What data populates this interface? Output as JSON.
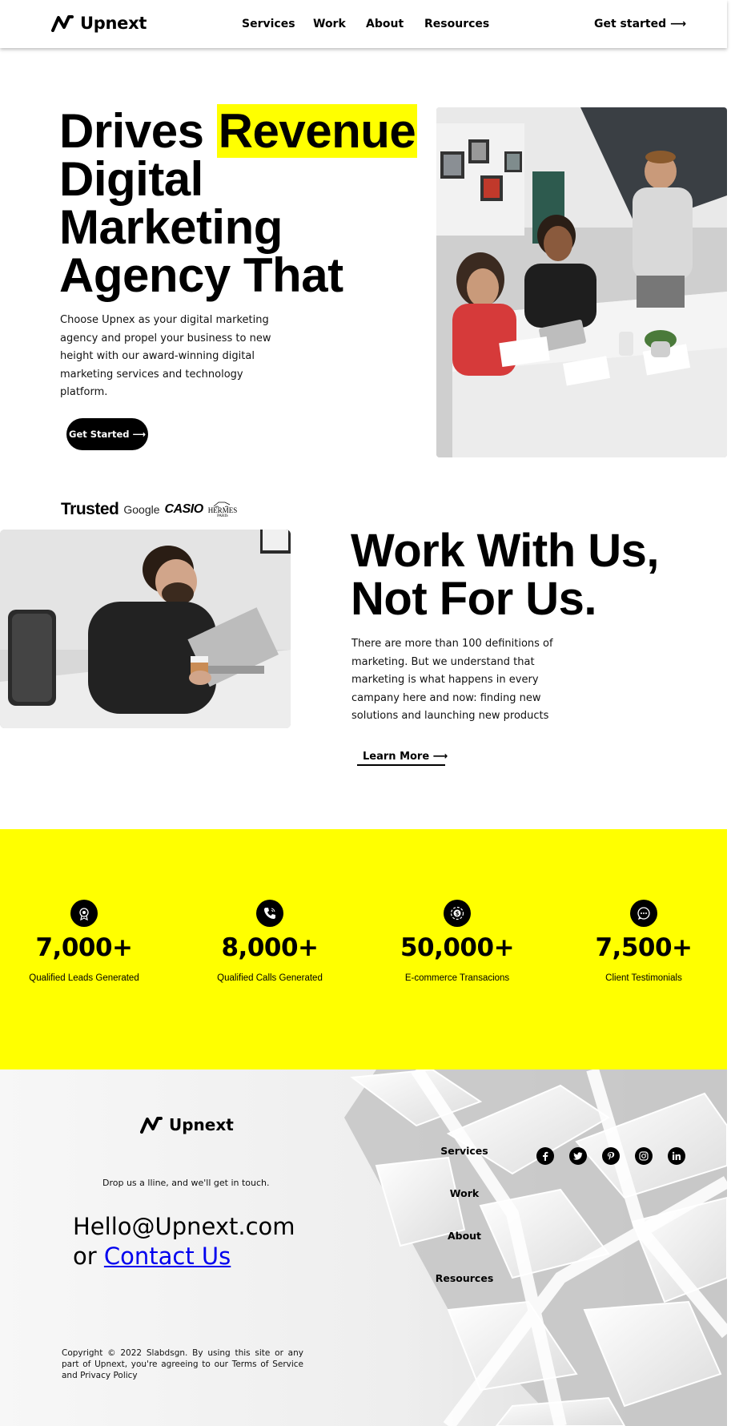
{
  "header": {
    "brand": "Upnext",
    "nav": [
      "Services",
      "Work",
      "About",
      "Resources"
    ],
    "cta": "Get started ⟶"
  },
  "hero": {
    "title_prefix": "Drives ",
    "title_highlight": "Revenue",
    "title_rest": "Digital Marketing Agency That",
    "description": "Choose Upnex as your digital marketing agency and propel your business to new height with our award-winning digital marketing services and technology platform.",
    "button": "Get Started ⟶"
  },
  "trusted": {
    "label": "Trusted",
    "brands": [
      "Google",
      "CASIO",
      "HERMES",
      "PARIS"
    ]
  },
  "work": {
    "title": "Work With Us, Not For Us.",
    "description": "There are more than 100 definitions of marketing. But we understand that marketing is what happens in every campany here and now: finding new solutions and launching new products",
    "link": "Learn More ⟶"
  },
  "stats": [
    {
      "icon": "badge-icon",
      "value": "7,000+",
      "label": "Qualified Leads Generated"
    },
    {
      "icon": "phone-icon",
      "value": "8,000+",
      "label": "Qualified Calls Generated"
    },
    {
      "icon": "dollar-icon",
      "value": "50,000+",
      "label": "E-commerce Transacions"
    },
    {
      "icon": "chat-icon",
      "value": "7,500+",
      "label": "Client Testimonials"
    }
  ],
  "footer": {
    "brand": "Upnext",
    "tagline": "Drop us a lline, and we'll get in touch.",
    "email": "Hello@Upnext.com",
    "or": "or ",
    "contact": "Contact Us",
    "nav": [
      "Services",
      "Work",
      "About",
      "Resources"
    ],
    "socials": [
      "facebook-icon",
      "twitter-icon",
      "pinterest-icon",
      "instagram-icon",
      "linkedin-icon"
    ],
    "copyright": "Copyright © 2022 Slabdsgn. By using this site or any part of Upnext, you're agreeing to our Terms of Service and Privacy Policy"
  },
  "colors": {
    "accent": "#ffff00",
    "dark": "#000000",
    "link": "#0000ee"
  }
}
